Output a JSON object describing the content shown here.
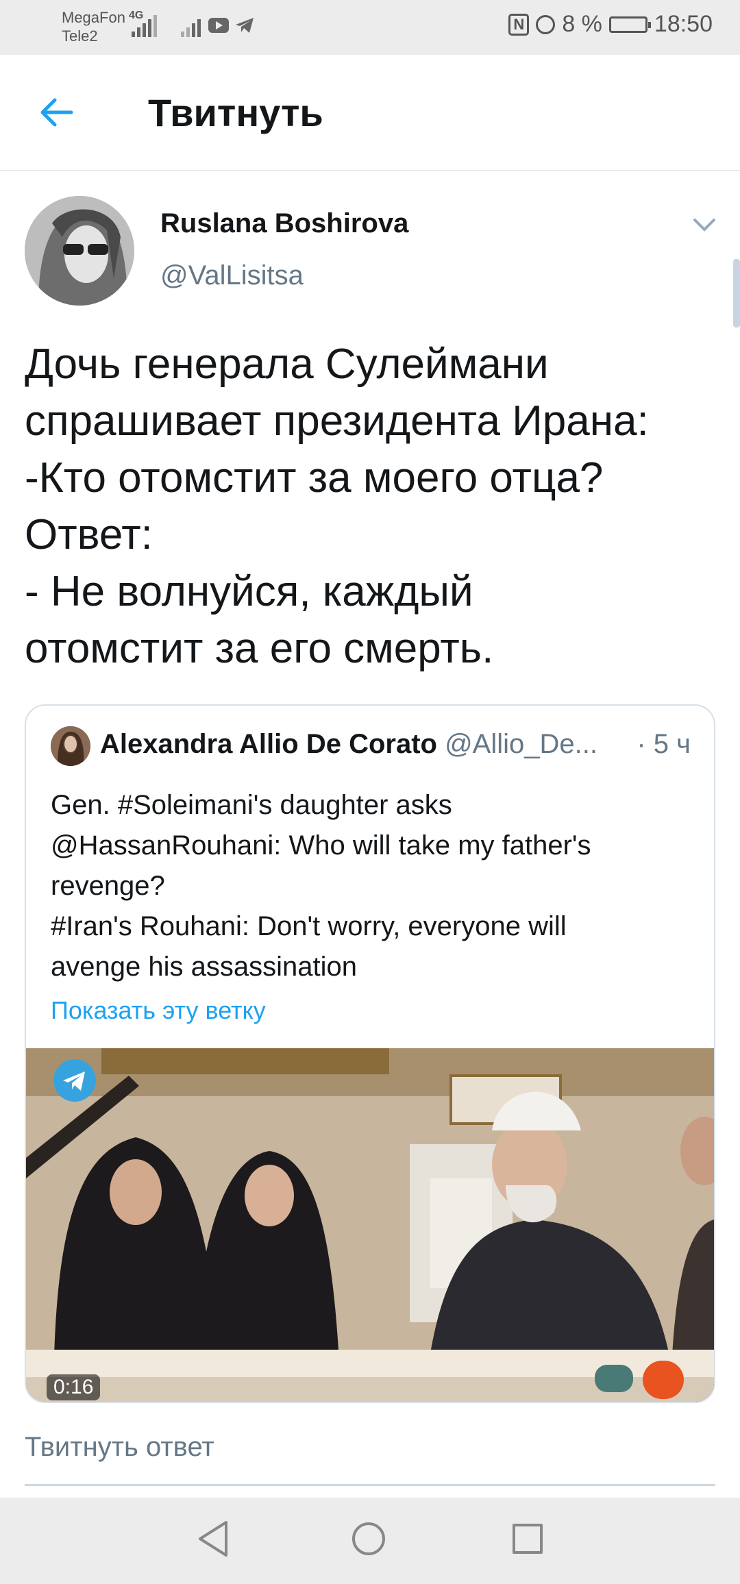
{
  "status_bar": {
    "carrier_1": "MegaFon",
    "carrier_2": "Tele2",
    "network": "4G",
    "battery": "8 %",
    "time": "18:50"
  },
  "header": {
    "title": "Твитнуть"
  },
  "tweet": {
    "author_name": "Ruslana Boshirova",
    "author_handle": "@ValLisitsa",
    "text_lines": [
      "Дочь генерала Сулеймани",
      "спрашивает президента Ирана:",
      "-Кто отомстит за моего отца?",
      "Ответ:",
      "- Не волнуйся, каждый",
      "отомстит за его смерть."
    ]
  },
  "quoted_tweet": {
    "author_name": "Alexandra Allio De Corato",
    "author_handle": "@Allio_De...",
    "time": "· 5 ч",
    "text_lines": [
      "Gen. #Soleimani's daughter asks",
      "@HassanRouhani: Who will take my father's",
      "revenge?",
      "#Iran's Rouhani: Don't worry, everyone will",
      "avenge his assassination"
    ],
    "show_thread": "Показать эту ветку",
    "video_duration": "0:16"
  },
  "reply": {
    "placeholder": "Твитнуть ответ"
  },
  "colors": {
    "accent": "#1da1f2",
    "secondary_text": "#657786",
    "primary_text": "#14171a"
  }
}
